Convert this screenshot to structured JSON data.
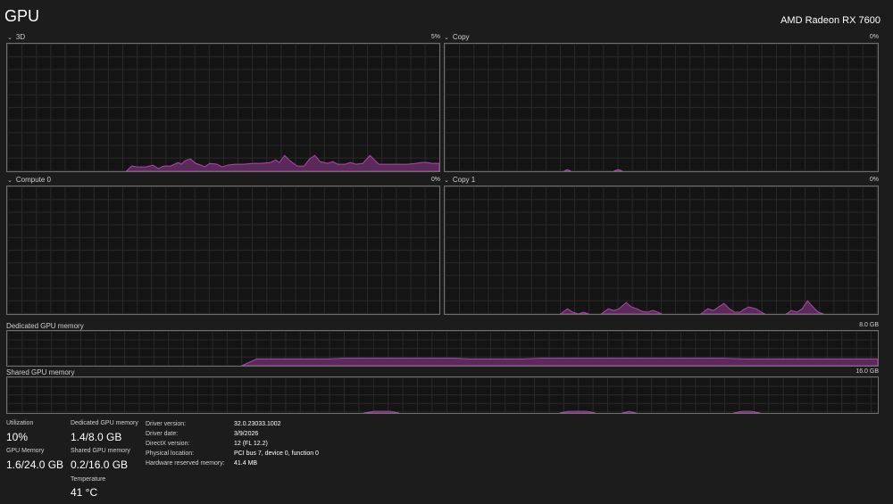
{
  "header": {
    "title": "GPU",
    "gpu_name": "AMD Radeon RX 7600"
  },
  "accent": "#a64ca6",
  "engines": [
    {
      "label": "3D",
      "max": "5%"
    },
    {
      "label": "Copy",
      "max": "0%"
    },
    {
      "label": "Compute 0",
      "max": "0%"
    },
    {
      "label": "Copy 1",
      "max": "0%"
    }
  ],
  "memory_graphs": {
    "dedicated": {
      "label": "Dedicated GPU memory",
      "max": "8.0 GB"
    },
    "shared": {
      "label": "Shared GPU memory",
      "max": "16.0 GB"
    }
  },
  "stats": {
    "utilization": {
      "label": "Utilization",
      "value": "10%"
    },
    "gpu_memory": {
      "label": "GPU Memory",
      "value": "1.6/24.0 GB"
    },
    "dedicated": {
      "label": "Dedicated GPU memory",
      "value": "1.4/8.0 GB"
    },
    "shared": {
      "label": "Shared GPU memory",
      "value": "0.2/16.0 GB"
    },
    "temperature": {
      "label": "Temperature",
      "value": "41 °C"
    }
  },
  "info": [
    {
      "label": "Driver version:",
      "value": "32.0.23033.1002"
    },
    {
      "label": "Driver date:",
      "value": "3/9/2026"
    },
    {
      "label": "DirectX version:",
      "value": "12 (FL 12.2)"
    },
    {
      "label": "Physical location:",
      "value": "PCI bus 7, device 0, function 0"
    },
    {
      "label": "Hardware reserved memory:",
      "value": "41.4 MB"
    }
  ],
  "chart_data": [
    {
      "type": "area",
      "title": "3D",
      "ylim": [
        0,
        5
      ],
      "x": [
        0,
        2,
        4,
        6,
        8,
        10,
        12,
        14,
        16,
        18,
        20,
        22,
        24,
        26,
        28,
        30,
        32,
        34,
        36,
        38,
        40,
        42,
        44,
        46,
        48,
        50,
        52,
        54,
        56,
        58,
        60
      ],
      "values": [
        0,
        0,
        0,
        0,
        0,
        0,
        0,
        0,
        0,
        0,
        0,
        0,
        0,
        0,
        0,
        0,
        0,
        0,
        0,
        0,
        0,
        0,
        0,
        0,
        0,
        0,
        0,
        0,
        0,
        0,
        0
      ]
    },
    {
      "type": "area",
      "title": "Copy",
      "ylim": [
        0,
        100
      ],
      "x": [
        0,
        10,
        20,
        30,
        40,
        50,
        60
      ],
      "values": [
        0,
        0,
        0,
        0,
        0,
        0,
        0
      ]
    },
    {
      "type": "area",
      "title": "Compute 0",
      "ylim": [
        0,
        100
      ],
      "x": [
        0,
        10,
        20,
        30,
        40,
        50,
        60
      ],
      "values": [
        0,
        0,
        0,
        0,
        0,
        0,
        0
      ]
    },
    {
      "type": "area",
      "title": "Copy 1",
      "ylim": [
        0,
        100
      ],
      "x": [
        0,
        10,
        20,
        30,
        40,
        50,
        60
      ],
      "values": [
        0,
        0,
        0,
        0,
        0,
        0,
        0
      ]
    },
    {
      "type": "area",
      "title": "Dedicated GPU memory",
      "ylim": [
        0,
        8.0
      ],
      "x": [
        0,
        10,
        20,
        30,
        40,
        50,
        60
      ],
      "values": [
        0,
        0,
        1.4,
        1.4,
        1.4,
        1.4,
        1.4
      ]
    },
    {
      "type": "area",
      "title": "Shared GPU memory",
      "ylim": [
        0,
        16.0
      ],
      "x": [
        0,
        10,
        20,
        30,
        40,
        50,
        60
      ],
      "values": [
        0,
        0,
        0.2,
        0.2,
        0.2,
        0.2,
        0.2
      ]
    }
  ]
}
